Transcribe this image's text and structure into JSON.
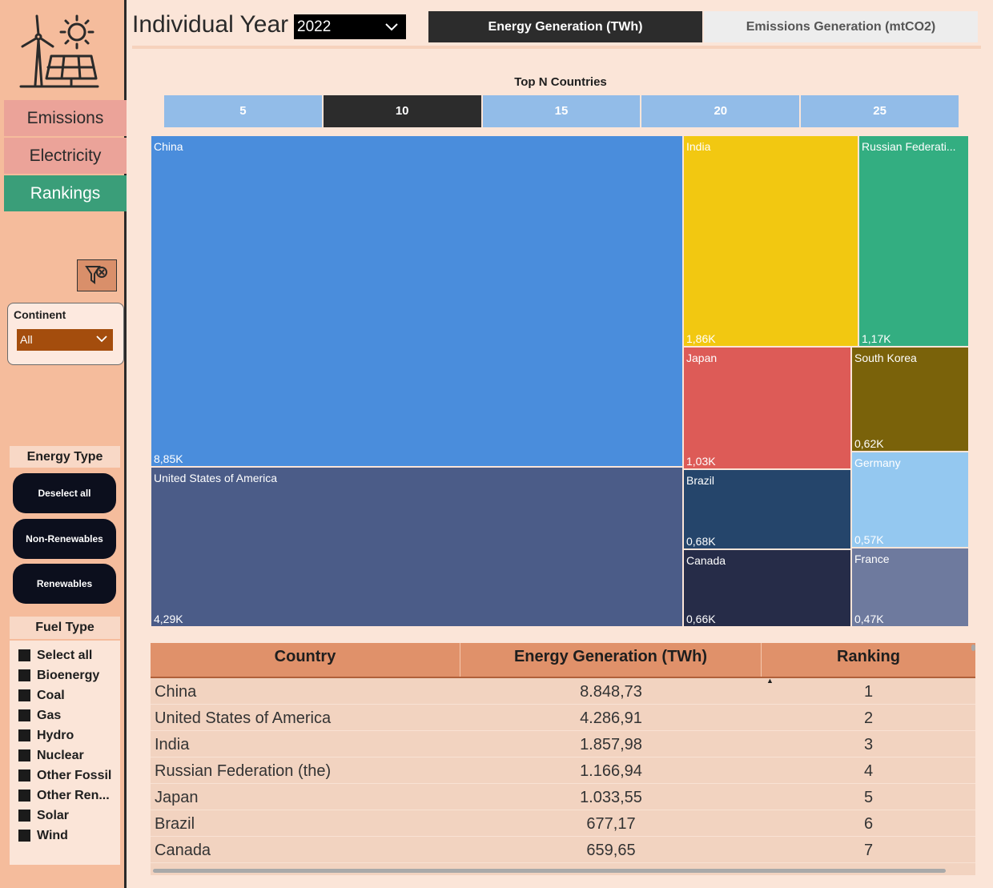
{
  "header": {
    "title": "Individual Year",
    "year": "2022",
    "tabs": {
      "energy": "Energy Generation (TWh)",
      "emissions": "Emissions Generation (mtCO2)"
    }
  },
  "sidebar": {
    "nav": {
      "emissions": "Emissions",
      "electricity": "Electricity",
      "rankings": "Rankings"
    },
    "continent": {
      "label": "Continent",
      "value": "All"
    },
    "energy_type": {
      "heading": "Energy Type",
      "buttons": {
        "deselect": "Deselect all",
        "non_renewables": "Non-Renewables",
        "renewables": "Renewables"
      }
    },
    "fuel_type": {
      "heading": "Fuel Type",
      "items": [
        "Select all",
        "Bioenergy",
        "Coal",
        "Gas",
        "Hydro",
        "Nuclear",
        "Other Fossil",
        "Other Ren...",
        "Solar",
        "Wind"
      ]
    }
  },
  "top_n": {
    "title": "Top N Countries",
    "options": [
      "5",
      "10",
      "15",
      "20",
      "25"
    ],
    "selected": "10"
  },
  "treemap": {
    "tiles": [
      {
        "name": "China",
        "value_label": "8,85K",
        "value": 8848.73,
        "color": "#4a8ddc"
      },
      {
        "name": "United States of America",
        "value_label": "4,29K",
        "value": 4286.91,
        "color": "#4b5c88"
      },
      {
        "name": "India",
        "value_label": "1,86K",
        "value": 1857.98,
        "color": "#f2c811"
      },
      {
        "name": "Russian Federati...",
        "value_label": "1,17K",
        "value": 1166.94,
        "color": "#33ae81"
      },
      {
        "name": "Japan",
        "value_label": "1,03K",
        "value": 1033.55,
        "color": "#dd5b57"
      },
      {
        "name": "South Korea",
        "value_label": "0,62K",
        "value": 620,
        "color": "#7a620a"
      },
      {
        "name": "Brazil",
        "value_label": "0,68K",
        "value": 677.17,
        "color": "#25456b"
      },
      {
        "name": "Germany",
        "value_label": "0,57K",
        "value": 570,
        "color": "#94c8f0"
      },
      {
        "name": "Canada",
        "value_label": "0,66K",
        "value": 659.65,
        "color": "#262c48"
      },
      {
        "name": "France",
        "value_label": "0,47K",
        "value": 470,
        "color": "#6e7a9e"
      }
    ]
  },
  "table": {
    "headers": {
      "country": "Country",
      "energy": "Energy Generation (TWh)",
      "ranking": "Ranking"
    },
    "rows": [
      {
        "country": "China",
        "energy": "8.848,73",
        "rank": "1"
      },
      {
        "country": "United States of America",
        "energy": "4.286,91",
        "rank": "2"
      },
      {
        "country": "India",
        "energy": "1.857,98",
        "rank": "3"
      },
      {
        "country": "Russian Federation (the)",
        "energy": "1.166,94",
        "rank": "4"
      },
      {
        "country": "Japan",
        "energy": "1.033,55",
        "rank": "5"
      },
      {
        "country": "Brazil",
        "energy": "677,17",
        "rank": "6"
      },
      {
        "country": "Canada",
        "energy": "659,65",
        "rank": "7"
      }
    ]
  }
}
